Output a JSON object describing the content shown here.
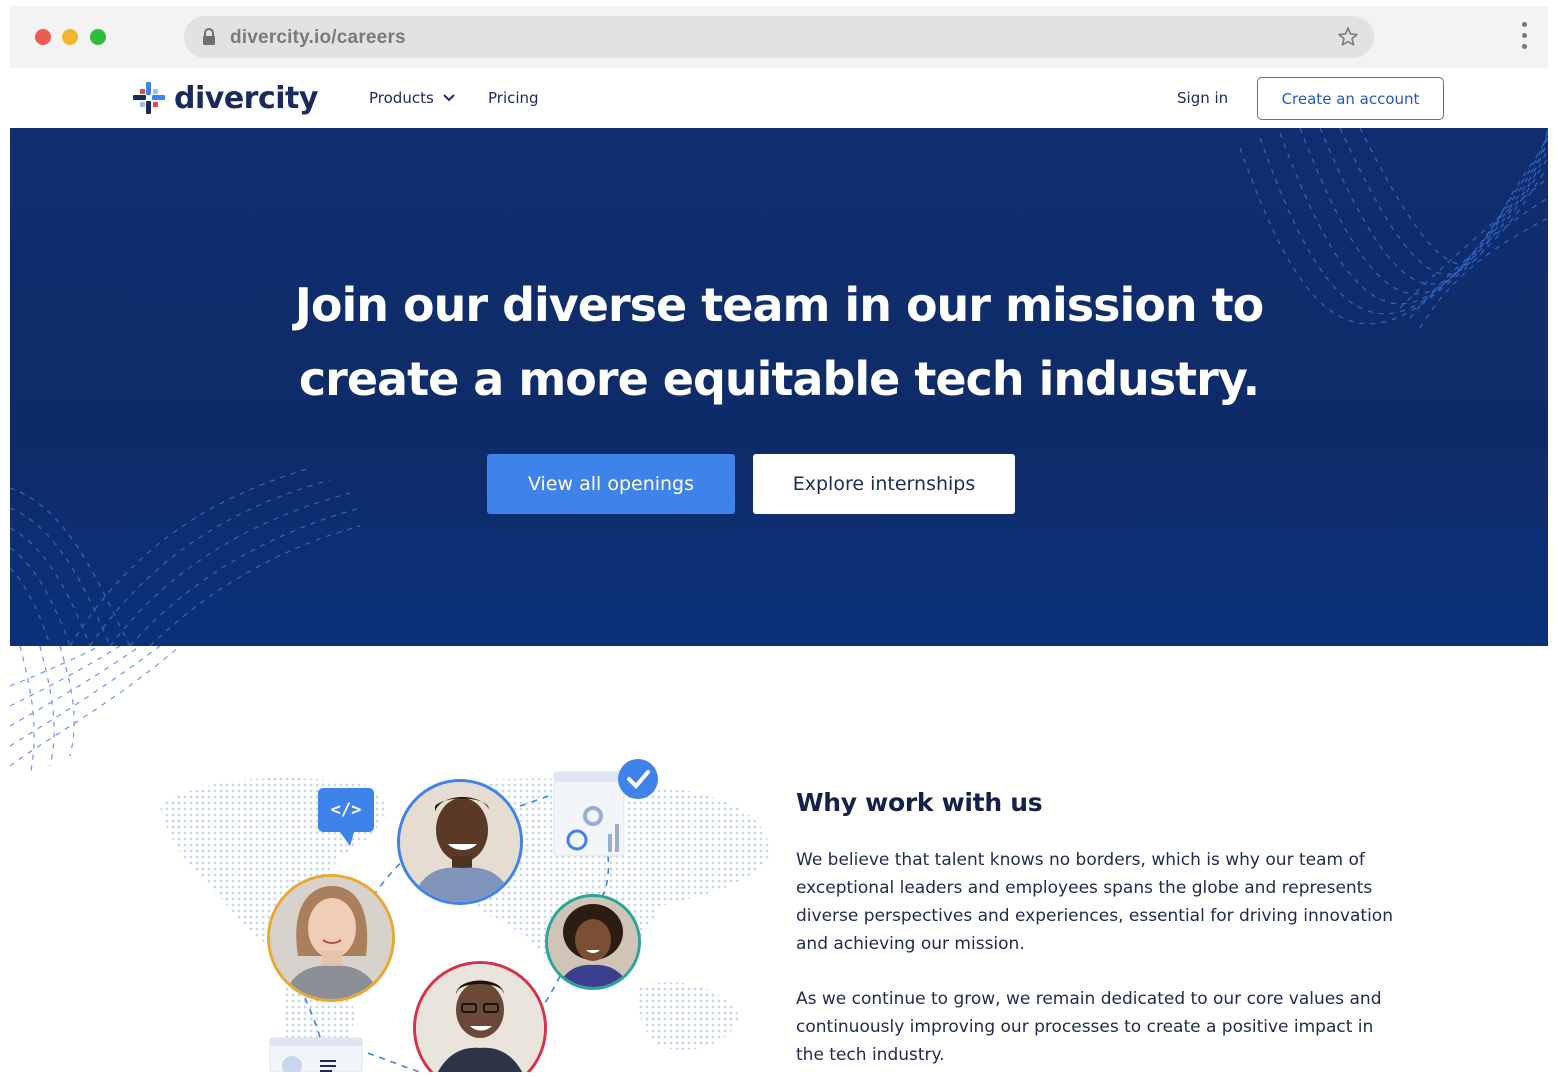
{
  "browser": {
    "url": "divercity.io/careers"
  },
  "nav": {
    "logo_text": "divercity",
    "products": "Products",
    "pricing": "Pricing",
    "sign_in": "Sign in",
    "create_account": "Create an account"
  },
  "hero": {
    "title_line1": "Join our diverse team in our mission to",
    "title_line2": "create a more equitable tech industry.",
    "primary_button": "View all openings",
    "secondary_button": "Explore internships"
  },
  "why": {
    "title": "Why work with us",
    "paragraph1": "We believe that talent knows no borders, which is why our team of exceptional leaders and employees spans the globe and represents diverse perspectives and experiences, essential for driving innovation and achieving our mission.",
    "paragraph2": "As we continue to grow, we remain dedicated to our core values and continuously improving our processes to create a positive impact in the tech industry.",
    "code_badge": "</>"
  },
  "colors": {
    "hero_bg": "#0e2b68",
    "primary": "#3f82ea",
    "brand_dark": "#1b2a5c"
  }
}
